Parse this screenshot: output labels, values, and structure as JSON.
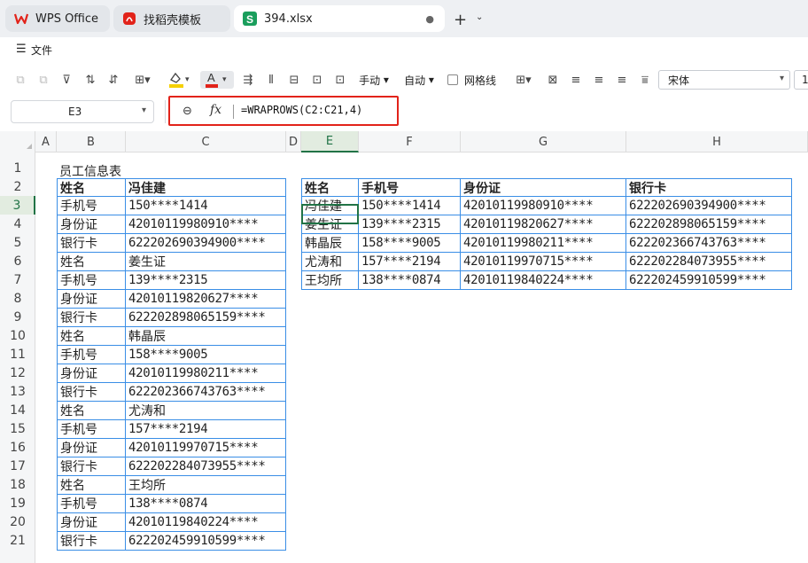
{
  "tabs": [
    {
      "label": "WPS Office"
    },
    {
      "label": "找稻壳模板"
    },
    {
      "label": "394.xlsx"
    }
  ],
  "menu": {
    "file_label": "文件"
  },
  "toolbar": {
    "manual_label": "手动",
    "auto_label": "自动",
    "gridlines_label": "网格线",
    "font_name": "宋体",
    "font_size": "1",
    "colors": {
      "highlight": "#f5d000",
      "font_color": "#e2231a"
    }
  },
  "formula_bar": {
    "cell_ref": "E3",
    "formula": "=WRAPROWS(C2:C21,4)"
  },
  "columns": [
    "A",
    "B",
    "C",
    "D",
    "E",
    "F",
    "G",
    "H"
  ],
  "rows": [
    "1",
    "2",
    "3",
    "4",
    "5",
    "6",
    "7",
    "8",
    "9",
    "10",
    "11",
    "12",
    "13",
    "14",
    "15",
    "16",
    "17",
    "18",
    "19",
    "20",
    "21"
  ],
  "sheet_title": "员工信息表",
  "source_table": [
    [
      "姓名",
      "冯佳建"
    ],
    [
      "手机号",
      "150****1414"
    ],
    [
      "身份证",
      "42010119980910****"
    ],
    [
      "银行卡",
      "622202690394900****"
    ],
    [
      "姓名",
      "姜生证"
    ],
    [
      "手机号",
      "139****2315"
    ],
    [
      "身份证",
      "42010119820627****"
    ],
    [
      "银行卡",
      "622202898065159****"
    ],
    [
      "姓名",
      "韩晶辰"
    ],
    [
      "手机号",
      "158****9005"
    ],
    [
      "身份证",
      "42010119980211****"
    ],
    [
      "银行卡",
      "622202366743763****"
    ],
    [
      "姓名",
      "尤涛和"
    ],
    [
      "手机号",
      "157****2194"
    ],
    [
      "身份证",
      "42010119970715****"
    ],
    [
      "银行卡",
      "622202284073955****"
    ],
    [
      "姓名",
      "王均所"
    ],
    [
      "手机号",
      "138****0874"
    ],
    [
      "身份证",
      "42010119840224****"
    ],
    [
      "银行卡",
      "622202459910599****"
    ]
  ],
  "result_table": {
    "headers": [
      "姓名",
      "手机号",
      "身份证",
      "银行卡"
    ],
    "rows": [
      [
        "冯佳建",
        "150****1414",
        "42010119980910****",
        "622202690394900****"
      ],
      [
        "姜生证",
        "139****2315",
        "42010119820627****",
        "622202898065159****"
      ],
      [
        "韩晶辰",
        "158****9005",
        "42010119980211****",
        "622202366743763****"
      ],
      [
        "尤涛和",
        "157****2194",
        "42010119970715****",
        "622202284073955****"
      ],
      [
        "王均所",
        "138****0874",
        "42010119840224****",
        "622202459910599****"
      ]
    ]
  }
}
